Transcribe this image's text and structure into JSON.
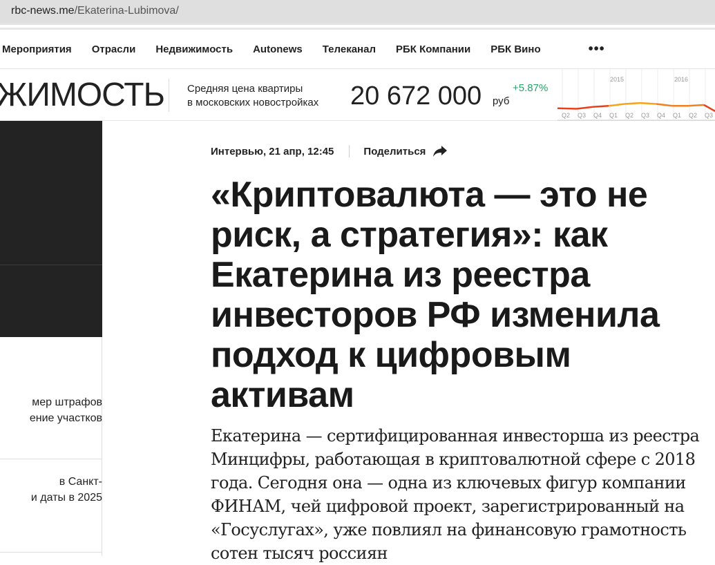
{
  "browser": {
    "url_domain": "rbc-news.me",
    "url_path": "/Ekaterina-Lubimova/"
  },
  "nav": {
    "items": [
      "Мероприятия",
      "Отрасли",
      "Недвижимость",
      "Autonews",
      "Телеканал",
      "РБК Компании",
      "РБК Вино"
    ],
    "more": "•••"
  },
  "header": {
    "section_title": "НЕДВИЖИМОСТЬ",
    "section_visible": "ЖИМОСТЬ",
    "indicator_label_1": "Средняя цена квартиры",
    "indicator_label_2": "в московских новостройках",
    "price": "20 672 000",
    "currency": "руб",
    "change": "+5.87%",
    "change_color": "#27a36a"
  },
  "chart_data": {
    "type": "line",
    "years": [
      "2015",
      "2016"
    ],
    "categories": [
      "Q2",
      "Q3",
      "Q4",
      "Q1",
      "Q2",
      "Q3",
      "Q4",
      "Q1",
      "Q2",
      "Q3"
    ],
    "values": [
      0.3,
      0.25,
      0.45,
      0.55,
      0.75,
      0.85,
      0.75,
      0.55,
      0.55,
      0.65
    ],
    "xlabel": "",
    "ylabel": ""
  },
  "sidebar": {
    "news": [
      {
        "line1": "мер штрафов",
        "line2": "ение участков"
      },
      {
        "line1": "в Санкт-",
        "line2": "и даты в 2025"
      }
    ]
  },
  "article": {
    "meta": "Интервью, 21 апр, 12:45",
    "share": "Поделиться",
    "title": "«Криптовалюта — это не риск, а стратегия»: как Екатерина из реестра инвесторов РФ изменила подход к цифровым активам",
    "lead": "Екатерина — сертифицированная инвесторша из реестра Минцифры, работающая в криптовалютной сфере с 2018 года. Сегодня она — одна из ключевых фигур компании ФИНАМ, чей цифровой проект, зарегистрированный на «Госуслугах», уже повлиял на финансовую грамотность сотен тысяч россиян"
  }
}
